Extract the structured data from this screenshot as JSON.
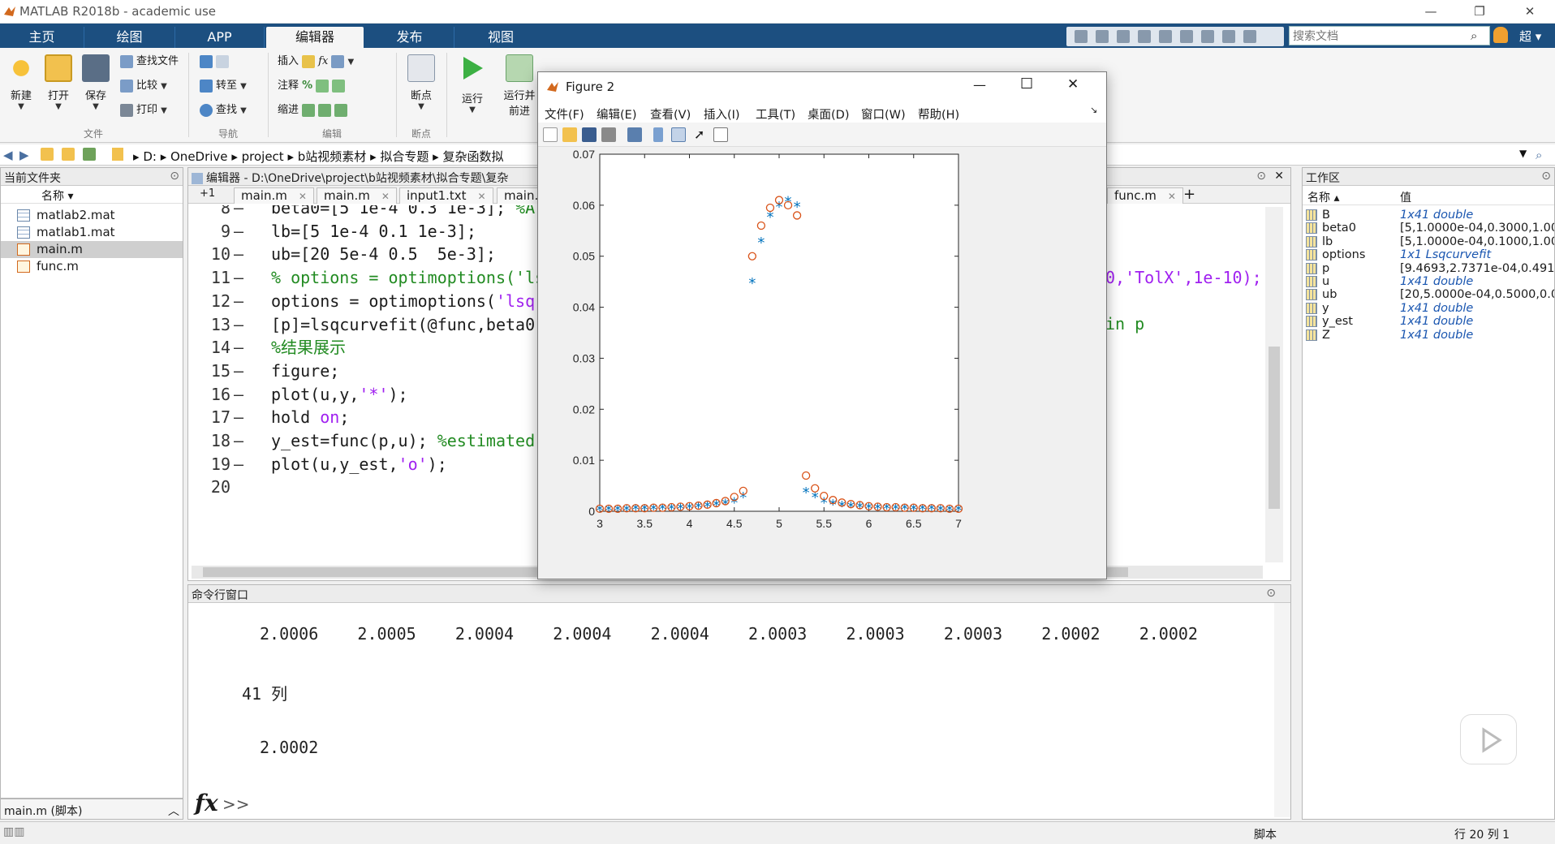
{
  "window": {
    "title": "MATLAB R2018b - academic use"
  },
  "ribbon_tabs": [
    "主页",
    "绘图",
    "APP",
    "编辑器",
    "发布",
    "视图"
  ],
  "search": {
    "placeholder": "搜索文档",
    "user": "超"
  },
  "ribbon": {
    "file": {
      "new": "新建",
      "open": "打开",
      "save": "保存",
      "find_file": "查找文件",
      "compare": "比较",
      "print": "打印",
      "group": "文件"
    },
    "navigate": {
      "goto": "转至",
      "find": "查找",
      "group": "导航"
    },
    "edit": {
      "insert": "插入",
      "comment": "注释",
      "indent": "缩进",
      "group": "编辑"
    },
    "breakpoints": {
      "label": "断点",
      "group": "断点"
    },
    "run": {
      "run": "运行",
      "run_advance_1": "运行并",
      "run_advance_2": "前进"
    }
  },
  "address": {
    "crumbs": [
      "D:",
      "OneDrive",
      "project",
      "b站视频素材",
      "拟合专题",
      "复杂函数拟"
    ]
  },
  "file_browser": {
    "title": "当前文件夹",
    "col_name": "名称",
    "files": [
      "matlab2.mat",
      "matlab1.mat",
      "main.m",
      "func.m"
    ],
    "selected": "main.m",
    "details": "main.m  (脚本)"
  },
  "editor": {
    "title": "编辑器 - D:\\OneDrive\\project\\b站视频素材\\拟合专题\\复杂",
    "tabs": [
      "+1",
      "main.m",
      "main.m",
      "input1.txt",
      "main.",
      "func.m"
    ],
    "right_fragments": {
      "line11": "0,'TolX',1e-10);",
      "line13": "in p"
    },
    "lines": [
      {
        "n": "8",
        "parts": [
          {
            "t": "beta0=[5 1e-4 0.3 1e-3]; ",
            "c": ""
          },
          {
            "t": "%A",
            "c": "com"
          }
        ]
      },
      {
        "n": "9",
        "parts": [
          {
            "t": "lb=[5 1e-4 0.1 1e-3];",
            "c": ""
          }
        ]
      },
      {
        "n": "10",
        "parts": [
          {
            "t": "ub=[20 5e-4 0.5  5e-3];",
            "c": ""
          }
        ]
      },
      {
        "n": "11",
        "parts": [
          {
            "t": "% options = optimoptions('ls",
            "c": "com"
          }
        ]
      },
      {
        "n": "12",
        "parts": [
          {
            "t": "options = optimoptions(",
            "c": ""
          },
          {
            "t": "'lsq",
            "c": "str"
          }
        ]
      },
      {
        "n": "13",
        "parts": [
          {
            "t": "[p]=lsqcurvefit(@func,beta0,",
            "c": ""
          }
        ]
      },
      {
        "n": "14",
        "parts": [
          {
            "t": "%结果展示",
            "c": "com"
          }
        ]
      },
      {
        "n": "15",
        "parts": [
          {
            "t": "figure;",
            "c": ""
          }
        ]
      },
      {
        "n": "16",
        "parts": [
          {
            "t": "plot(u,y,",
            "c": ""
          },
          {
            "t": "'*'",
            "c": "str"
          },
          {
            "t": ");",
            "c": ""
          }
        ]
      },
      {
        "n": "17",
        "parts": [
          {
            "t": "hold ",
            "c": ""
          },
          {
            "t": "on",
            "c": "str"
          },
          {
            "t": ";",
            "c": ""
          }
        ]
      },
      {
        "n": "18",
        "parts": [
          {
            "t": "y_est=func(p,u); ",
            "c": ""
          },
          {
            "t": "%estimated",
            "c": "com"
          }
        ]
      },
      {
        "n": "19",
        "parts": [
          {
            "t": "plot(u,y_est,",
            "c": ""
          },
          {
            "t": "'o'",
            "c": "str"
          },
          {
            "t": ");",
            "c": ""
          }
        ]
      },
      {
        "n": "20",
        "parts": []
      }
    ]
  },
  "workspace": {
    "title": "工作区",
    "col_name": "名称",
    "col_value": "值",
    "vars": [
      {
        "name": "B",
        "value": "1x41 double",
        "italic": true
      },
      {
        "name": "beta0",
        "value": "[5,1.0000e-04,0.3000,1.00",
        "italic": false
      },
      {
        "name": "lb",
        "value": "[5,1.0000e-04,0.1000,1.00",
        "italic": false
      },
      {
        "name": "options",
        "value": "1x1 Lsqcurvefit",
        "italic": true
      },
      {
        "name": "p",
        "value": "[9.4693,2.7371e-04,0.4918",
        "italic": false
      },
      {
        "name": "u",
        "value": "1x41 double",
        "italic": true
      },
      {
        "name": "ub",
        "value": "[20,5.0000e-04,0.5000,0.0",
        "italic": false
      },
      {
        "name": "y",
        "value": "1x41 double",
        "italic": true
      },
      {
        "name": "y_est",
        "value": "1x41 double",
        "italic": true
      },
      {
        "name": "Z",
        "value": "1x41 double",
        "italic": true
      }
    ]
  },
  "command_window": {
    "title": "命令行窗口",
    "row1": "2.0006    2.0005    2.0004    2.0004    2.0004    2.0003    2.0003    2.0003    2.0002    2.0002",
    "col_label": "41 列",
    "row2": "2.0002",
    "prompt": ">>"
  },
  "status": {
    "mode": "脚本",
    "position": "行 20  列 1"
  },
  "figure": {
    "title": "Figure 2",
    "menu": [
      "文件(F)",
      "编辑(E)",
      "查看(V)",
      "插入(I)",
      "工具(T)",
      "桌面(D)",
      "窗口(W)",
      "帮助(H)"
    ]
  },
  "colors": {
    "series_star": "#0072bd",
    "series_circle": "#d95319",
    "tabbar": "#1c4f80"
  },
  "chart_data": {
    "type": "scatter",
    "xlim": [
      3,
      7
    ],
    "ylim": [
      0,
      0.07
    ],
    "xticks": [
      "3",
      "3.5",
      "4",
      "4.5",
      "5",
      "5.5",
      "6",
      "6.5",
      "7"
    ],
    "yticks": [
      "0",
      "0.01",
      "0.02",
      "0.03",
      "0.04",
      "0.05",
      "0.06",
      "0.07"
    ],
    "grid": false,
    "series": [
      {
        "marker": "*",
        "color": "#0072bd",
        "x": [
          3.0,
          3.1,
          3.2,
          3.3,
          3.4,
          3.5,
          3.6,
          3.7,
          3.8,
          3.9,
          4.0,
          4.1,
          4.2,
          4.3,
          4.4,
          4.5,
          4.6,
          4.7,
          4.8,
          4.9,
          5.0,
          5.1,
          5.2,
          5.3,
          5.4,
          5.5,
          5.6,
          5.7,
          5.8,
          5.9,
          6.0,
          6.1,
          6.2,
          6.3,
          6.4,
          6.5,
          6.6,
          6.7,
          6.8,
          6.9,
          7.0
        ],
        "y": [
          0.0005,
          0.0005,
          0.0005,
          0.0005,
          0.0006,
          0.0006,
          0.0006,
          0.0007,
          0.0007,
          0.0008,
          0.0009,
          0.001,
          0.0012,
          0.0014,
          0.0017,
          0.002,
          0.003,
          0.045,
          0.053,
          0.058,
          0.06,
          0.061,
          0.06,
          0.004,
          0.003,
          0.002,
          0.0016,
          0.0013,
          0.0011,
          0.001,
          0.0009,
          0.0008,
          0.0008,
          0.0007,
          0.0007,
          0.0006,
          0.0006,
          0.0006,
          0.0005,
          0.0005,
          0.0005
        ]
      },
      {
        "marker": "o",
        "color": "#d95319",
        "x": [
          3.0,
          3.1,
          3.2,
          3.3,
          3.4,
          3.5,
          3.6,
          3.7,
          3.8,
          3.9,
          4.0,
          4.1,
          4.2,
          4.3,
          4.4,
          4.5,
          4.6,
          4.7,
          4.8,
          4.9,
          5.0,
          5.1,
          5.2,
          5.3,
          5.4,
          5.5,
          5.6,
          5.7,
          5.8,
          5.9,
          6.0,
          6.1,
          6.2,
          6.3,
          6.4,
          6.5,
          6.6,
          6.7,
          6.8,
          6.9,
          7.0
        ],
        "y": [
          0.0005,
          0.0005,
          0.0005,
          0.0006,
          0.0006,
          0.0006,
          0.0007,
          0.0007,
          0.0008,
          0.0009,
          0.001,
          0.0011,
          0.0013,
          0.0016,
          0.002,
          0.0028,
          0.004,
          0.05,
          0.056,
          0.0595,
          0.061,
          0.06,
          0.058,
          0.007,
          0.0045,
          0.003,
          0.0022,
          0.0017,
          0.0014,
          0.0012,
          0.001,
          0.0009,
          0.0008,
          0.0008,
          0.0007,
          0.0007,
          0.0006,
          0.0006,
          0.0006,
          0.0005,
          0.0005
        ]
      }
    ]
  }
}
